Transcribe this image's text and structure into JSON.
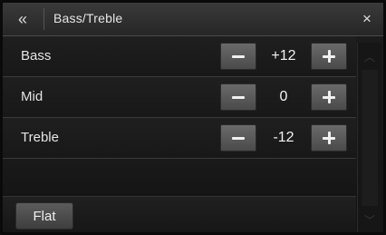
{
  "header": {
    "back_glyph": "«",
    "title": "Bass/Treble",
    "close_glyph": "×"
  },
  "rows": [
    {
      "label": "Bass",
      "value": "+12"
    },
    {
      "label": "Mid",
      "value": "0"
    },
    {
      "label": "Treble",
      "value": "-12"
    }
  ],
  "footer": {
    "flat_label": "Flat"
  },
  "scrollbar": {
    "up_glyph": "︿",
    "down_glyph": "﹀"
  },
  "icons": {
    "back": "double-chevron-left-icon",
    "close": "close-icon",
    "minus": "minus-icon",
    "plus": "plus-icon",
    "scroll_up": "chevron-up-icon",
    "scroll_down": "chevron-down-icon"
  },
  "colors": {
    "background": "#141414",
    "header": "#2e2e2e",
    "button": "#5a5a5a",
    "text": "#e8e8e8"
  }
}
